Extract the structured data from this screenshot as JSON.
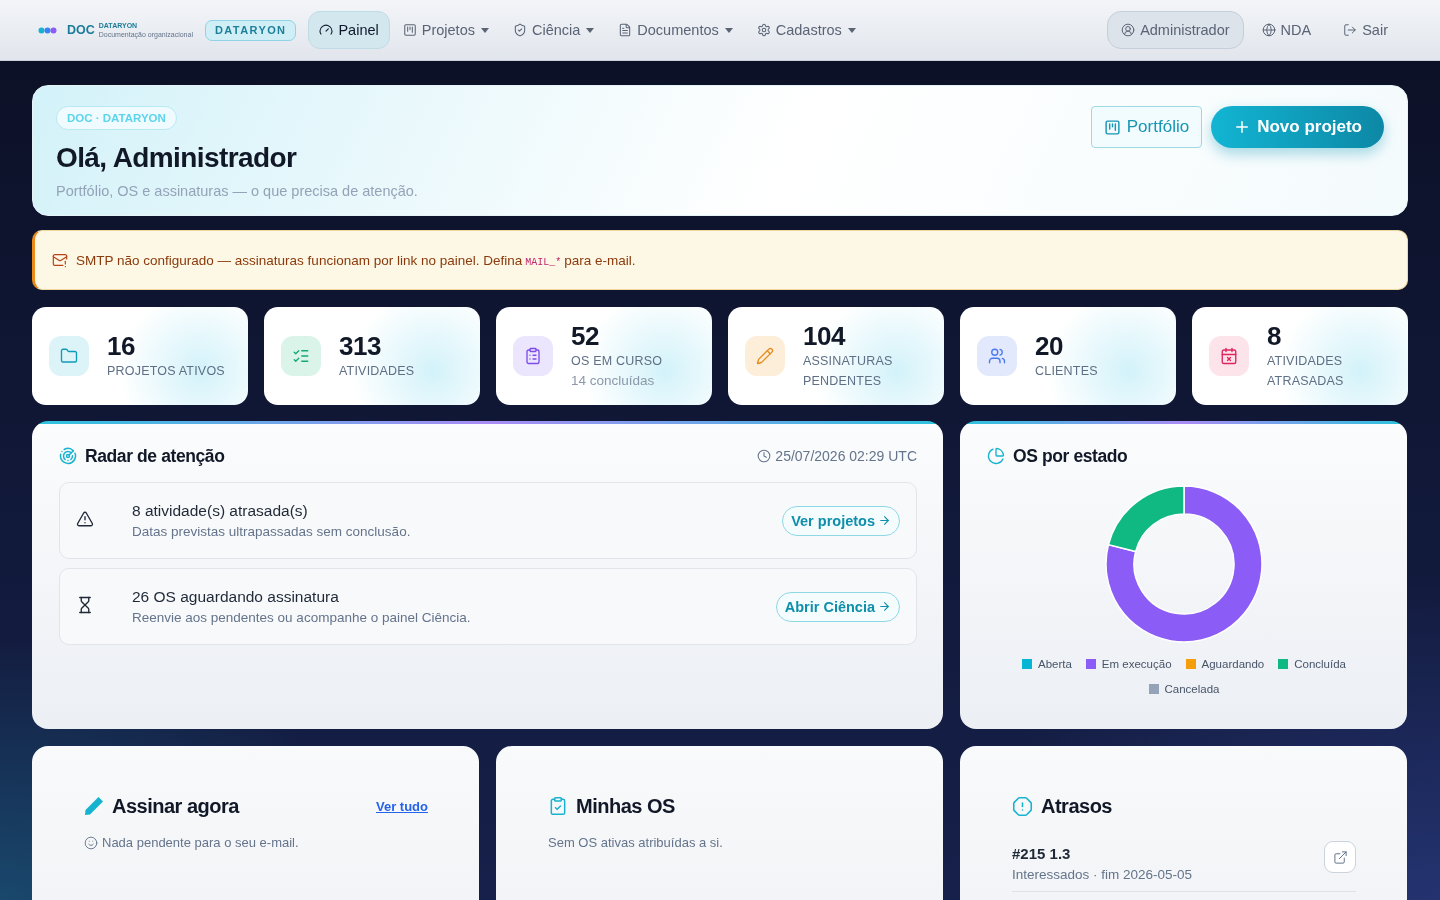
{
  "nav": {
    "logo": {
      "title": "DOC",
      "brand": "DATARYON",
      "tagline": "Documentação organizacional"
    },
    "badge": "DATARYON",
    "items": [
      {
        "label": "Painel",
        "selected": true,
        "menu": false
      },
      {
        "label": "Projetos",
        "selected": false,
        "menu": true
      },
      {
        "label": "Ciência",
        "selected": false,
        "menu": true
      },
      {
        "label": "Documentos",
        "selected": false,
        "menu": true
      },
      {
        "label": "Cadastros",
        "selected": false,
        "menu": true
      }
    ],
    "account": [
      {
        "label": "Administrador",
        "kind": "pill"
      },
      {
        "label": "NDA",
        "kind": "plain"
      },
      {
        "label": "Sair",
        "kind": "plain"
      }
    ]
  },
  "header": {
    "chip": "DOC · DATARYON",
    "title": "Olá, Administrador",
    "subtitle": "Portfólio, OS e assinaturas — o que precisa de atenção.",
    "buttons": [
      {
        "label": "Portfólio",
        "kind": "outline"
      },
      {
        "label": "Novo projeto",
        "kind": "primary"
      }
    ]
  },
  "alert": {
    "text_before": "SMTP não configurado — assinaturas funcionam por link no painel. Defina",
    "code": "MAIL_*",
    "text_after": "para e-mail."
  },
  "stats": [
    {
      "value": "16",
      "label": "PROJETOS ATIVOS"
    },
    {
      "value": "313",
      "label": "ATIVIDADES"
    },
    {
      "value": "52",
      "label": "OS EM CURSO",
      "note": "14 concluídas"
    },
    {
      "value": "104",
      "label": "ASSINATURAS PENDENTES"
    },
    {
      "value": "20",
      "label": "CLIENTES"
    },
    {
      "value": "8",
      "label": "ATIVIDADES ATRASADAS"
    }
  ],
  "radar": {
    "title": "Radar de atenção",
    "timestamp": "25/07/2026 02:29 UTC",
    "items": [
      {
        "kind": "warning",
        "title": "8 atividade(s) atrasada(s)",
        "text": "Datas previstas ultrapassadas sem conclusão.",
        "action": "Ver projetos"
      },
      {
        "kind": "pending",
        "title": "26 OS aguardando assinatura",
        "text": "Reenvie aos pendentes ou acompanhe o painel Ciência.",
        "action": "Abrir Ciência"
      }
    ]
  },
  "os_status": {
    "title": "OS por estado",
    "legend": [
      {
        "color": "#06b6d4"
      },
      {
        "color": "#8b5cf6"
      },
      {
        "color": "#f59e0b"
      },
      {
        "color": "#10b981"
      },
      {
        "color": "#94a3b8"
      }
    ],
    "chart_data": {
      "type": "donut",
      "categories": [
        "Aberta",
        "Em execução",
        "Aguardando",
        "Concluída",
        "Cancelada"
      ],
      "values": [
        0,
        79,
        0,
        21,
        0
      ]
    }
  },
  "sign": {
    "title": "Assinar agora",
    "link": "Ver tudo",
    "empty": "Nada pendente para o seu e-mail."
  },
  "my_os": {
    "title": "Minhas OS",
    "empty": "Sem OS ativas atribuídas a si."
  },
  "delays": {
    "title": "Atrasos",
    "items": [
      {
        "code": "#215 1.3",
        "detail": "Interessados · fim 2026-05-05"
      }
    ]
  }
}
